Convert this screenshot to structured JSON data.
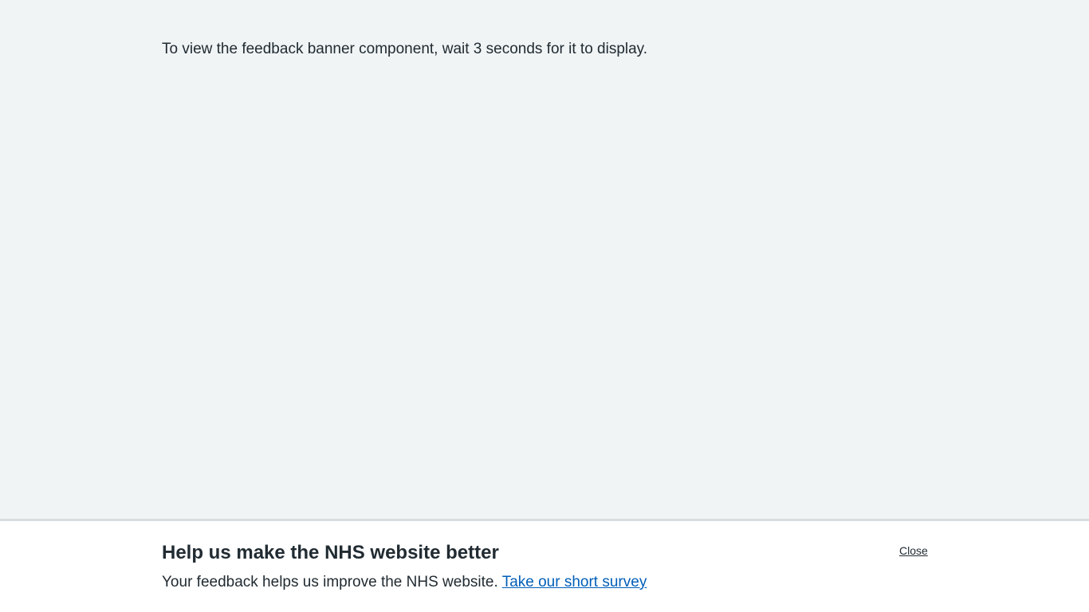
{
  "intro": {
    "text": "To view the feedback banner component, wait 3 seconds for it to display."
  },
  "feedback_banner": {
    "heading": "Help us make the NHS website better",
    "text": "Your feedback helps us improve the NHS website.",
    "link_label": "Take our short survey",
    "close_label": "Close"
  },
  "colors": {
    "page_background": "#f0f4f5",
    "banner_background": "#ffffff",
    "text": "#212b32",
    "link": "#005eb8",
    "banner_border": "#d8dde0"
  }
}
